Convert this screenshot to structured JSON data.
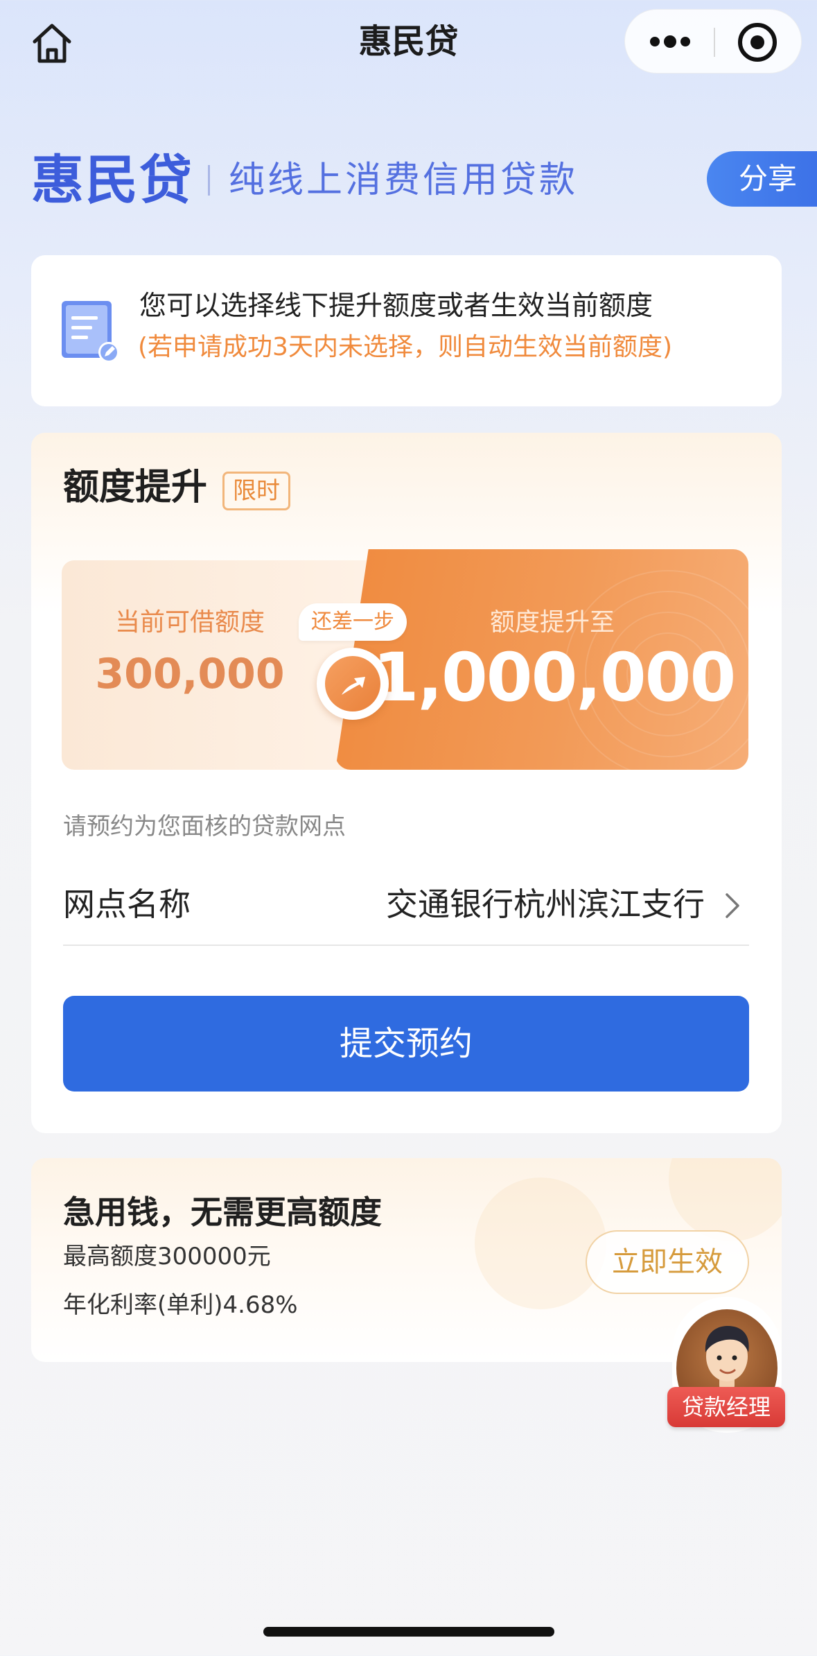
{
  "nav": {
    "title": "惠民贷",
    "home_icon": "home-icon",
    "more_icon": "more-dots-icon",
    "close_icon": "target-close-icon"
  },
  "brand": {
    "name": "惠民贷",
    "tagline": "纯线上消费信用贷款",
    "share_label": "分享"
  },
  "notice": {
    "icon": "document-edit-icon",
    "main": "您可以选择线下提升额度或者生效当前额度",
    "sub": "(若申请成功3天内未选择，则自动生效当前额度)"
  },
  "quota": {
    "title": "额度提升",
    "badge": "限时",
    "current_label": "当前可借额度",
    "current_value": "300,000",
    "step_tag": "还差一步",
    "upgrade_label": "额度提升至",
    "upgrade_value": "1,000,000",
    "branch_hint": "请预约为您面核的贷款网点",
    "branch_key": "网点名称",
    "branch_value": "交通银行杭州滨江支行",
    "submit_label": "提交预约"
  },
  "promo": {
    "title": "急用钱，无需更高额度",
    "max_line": "最高额度300000元",
    "rate_line": "年化利率(单利)4.68%",
    "activate_label": "立即生效"
  },
  "manager": {
    "label": "贷款经理"
  },
  "colors": {
    "brand_blue": "#3d5ddb",
    "primary_button": "#2f6be0",
    "accent_orange": "#ef8a3e",
    "manager_red": "#d83a36"
  }
}
